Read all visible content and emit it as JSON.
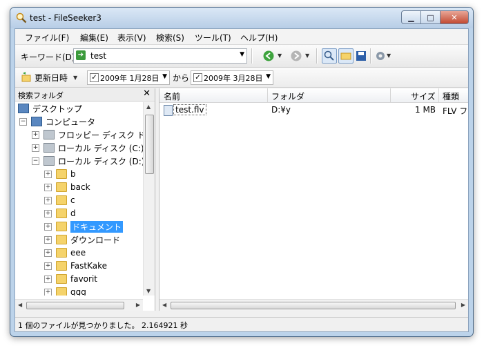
{
  "window": {
    "title": "test - FileSeeker3",
    "controls": {
      "minimize": "▁",
      "maximize": "□",
      "close": "✕"
    }
  },
  "menu": [
    "ファイル(F)",
    "編集(E)",
    "表示(V)",
    "検索(S)",
    "ツール(T)",
    "ヘルプ(H)"
  ],
  "toolbar": {
    "keyword_label": "キーワード(D)",
    "keyword_value": "test"
  },
  "filter": {
    "sort_label": "更新日時",
    "date_from": "2009年  1月28日",
    "between": "から",
    "date_to": "2009年  3月28日"
  },
  "left_pane": {
    "title": "検索フォルダ",
    "close": "✕",
    "tree": [
      {
        "label": "デスクトップ",
        "level": 0,
        "icon": "desktop-icon"
      },
      {
        "label": "コンピュータ",
        "level": 1,
        "icon": "computer-icon",
        "expander": "−"
      },
      {
        "label": "フロッピー ディスク ドラ",
        "level": 2,
        "icon": "floppy-icon",
        "expander": "+"
      },
      {
        "label": "ローカル ディスク (C:)",
        "level": 2,
        "icon": "drive-icon",
        "expander": "+"
      },
      {
        "label": "ローカル ディスク (D:)",
        "level": 2,
        "icon": "drive-icon",
        "expander": "−"
      },
      {
        "label": "b",
        "level": 3,
        "icon": "folder-icon",
        "expander": "+"
      },
      {
        "label": "back",
        "level": 3,
        "icon": "folder-icon",
        "expander": "+"
      },
      {
        "label": "c",
        "level": 3,
        "icon": "folder-icon",
        "expander": "+"
      },
      {
        "label": "d",
        "level": 3,
        "icon": "folder-icon",
        "expander": "+"
      },
      {
        "label": "ドキュメント",
        "level": 3,
        "icon": "documents-icon",
        "expander": "+",
        "selected": true
      },
      {
        "label": "ダウンロード",
        "level": 3,
        "icon": "downloads-icon",
        "expander": "+"
      },
      {
        "label": "eee",
        "level": 3,
        "icon": "folder-icon",
        "expander": "+"
      },
      {
        "label": "FastKake",
        "level": 3,
        "icon": "folder-icon",
        "expander": "+"
      },
      {
        "label": "favorit",
        "level": 3,
        "icon": "folder-icon",
        "expander": "+"
      },
      {
        "label": "ggg",
        "level": 3,
        "icon": "folder-icon",
        "expander": "+"
      }
    ]
  },
  "results": {
    "columns": [
      "名前",
      "フォルダ",
      "サイズ",
      "種類"
    ],
    "rows": [
      {
        "name": "test.flv",
        "folder": "D:¥y",
        "size": "1 MB",
        "type": "FLV フ"
      }
    ]
  },
  "status": "1 個のファイルが見つかりました。 2.164921 秒"
}
